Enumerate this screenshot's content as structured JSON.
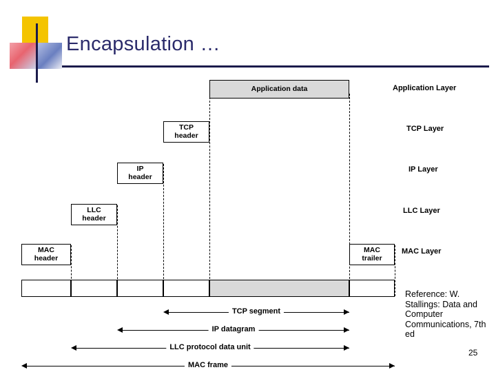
{
  "slide": {
    "title": "Encapsulation …",
    "number": "25",
    "reference": "Reference: W. Stallings: Data and Computer Communications, 7th ed"
  },
  "diagram": {
    "headers": [
      {
        "id": "application-data",
        "label": "Application data",
        "shaded": true
      },
      {
        "id": "tcp-header",
        "label": "TCP\nheader",
        "shaded": false
      },
      {
        "id": "ip-header",
        "label": "IP\nheader",
        "shaded": false
      },
      {
        "id": "llc-header",
        "label": "LLC\nheader",
        "shaded": false
      },
      {
        "id": "mac-header",
        "label": "MAC\nheader",
        "shaded": false
      },
      {
        "id": "mac-trailer",
        "label": "MAC\ntrailer",
        "shaded": false
      }
    ],
    "layers": [
      {
        "id": "application-layer",
        "label": "Application Layer"
      },
      {
        "id": "tcp-layer",
        "label": "TCP Layer"
      },
      {
        "id": "ip-layer",
        "label": "IP Layer"
      },
      {
        "id": "llc-layer",
        "label": "LLC Layer"
      },
      {
        "id": "mac-layer",
        "label": "MAC Layer"
      }
    ],
    "spans": [
      {
        "id": "tcp-segment",
        "label": "TCP segment"
      },
      {
        "id": "ip-datagram",
        "label": "IP datagram"
      },
      {
        "id": "llc-pdu",
        "label": "LLC protocol data unit"
      },
      {
        "id": "mac-frame",
        "label": "MAC frame"
      }
    ]
  },
  "colors": {
    "title": "#2b2b6b",
    "rule": "#1b1b4b",
    "shaded_fill": "#d9d9d9",
    "logo_yellow": "#f4c400"
  }
}
